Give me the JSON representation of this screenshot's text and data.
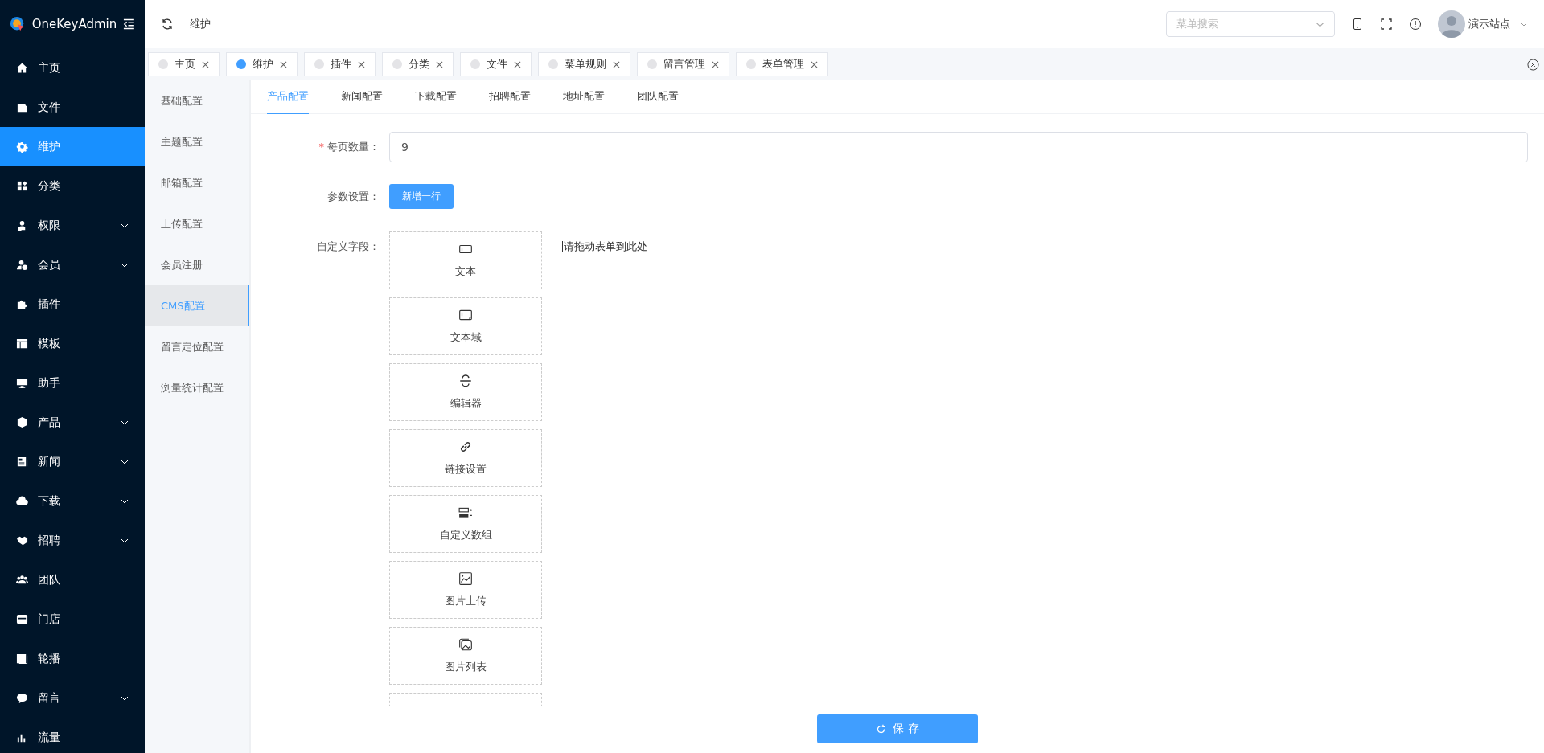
{
  "brand": {
    "name": "OneKeyAdmin"
  },
  "sidebar": {
    "items": [
      {
        "label": "主页",
        "selected": false,
        "expandable": false
      },
      {
        "label": "文件",
        "selected": false,
        "expandable": false
      },
      {
        "label": "维护",
        "selected": true,
        "expandable": false
      },
      {
        "label": "分类",
        "selected": false,
        "expandable": false
      },
      {
        "label": "权限",
        "selected": false,
        "expandable": true
      },
      {
        "label": "会员",
        "selected": false,
        "expandable": true
      },
      {
        "label": "插件",
        "selected": false,
        "expandable": false
      },
      {
        "label": "模板",
        "selected": false,
        "expandable": false
      },
      {
        "label": "助手",
        "selected": false,
        "expandable": false
      },
      {
        "label": "产品",
        "selected": false,
        "expandable": true
      },
      {
        "label": "新闻",
        "selected": false,
        "expandable": true
      },
      {
        "label": "下载",
        "selected": false,
        "expandable": true
      },
      {
        "label": "招聘",
        "selected": false,
        "expandable": true
      },
      {
        "label": "团队",
        "selected": false,
        "expandable": false
      },
      {
        "label": "门店",
        "selected": false,
        "expandable": false
      },
      {
        "label": "轮播",
        "selected": false,
        "expandable": false
      },
      {
        "label": "留言",
        "selected": false,
        "expandable": true
      },
      {
        "label": "流量",
        "selected": false,
        "expandable": false
      }
    ]
  },
  "header": {
    "breadcrumb": "维护",
    "menu_search": {
      "placeholder": "菜单搜索"
    },
    "user": "演示站点"
  },
  "tabs": [
    {
      "label": "主页",
      "selected": false
    },
    {
      "label": "维护",
      "selected": true
    },
    {
      "label": "插件",
      "selected": false
    },
    {
      "label": "分类",
      "selected": false
    },
    {
      "label": "文件",
      "selected": false
    },
    {
      "label": "菜单规则",
      "selected": false
    },
    {
      "label": "留言管理",
      "selected": false
    },
    {
      "label": "表单管理",
      "selected": false
    }
  ],
  "config_menu": [
    {
      "label": "基础配置",
      "selected": false
    },
    {
      "label": "主题配置",
      "selected": false
    },
    {
      "label": "邮箱配置",
      "selected": false
    },
    {
      "label": "上传配置",
      "selected": false
    },
    {
      "label": "会员注册",
      "selected": false
    },
    {
      "label": "CMS配置",
      "selected": true
    },
    {
      "label": "留言定位配置",
      "selected": false
    },
    {
      "label": "浏量统计配置",
      "selected": false
    }
  ],
  "sub_tabs": [
    {
      "label": "产品配置",
      "selected": true
    },
    {
      "label": "新闻配置",
      "selected": false
    },
    {
      "label": "下载配置",
      "selected": false
    },
    {
      "label": "招聘配置",
      "selected": false
    },
    {
      "label": "地址配置",
      "selected": false
    },
    {
      "label": "团队配置",
      "selected": false
    }
  ],
  "form": {
    "per_page": {
      "label": "每页数量：",
      "required_mark": "*",
      "value": "9"
    },
    "params": {
      "label": "参数设置：",
      "button": "新增一行"
    },
    "custom_fields": {
      "label": "自定义字段：",
      "drop_hint": "请拖动表单到此处",
      "components": [
        {
          "kind": "field",
          "label": "文本"
        },
        {
          "kind": "field",
          "label": "文本域"
        },
        {
          "kind": "field",
          "label": "编辑器"
        },
        {
          "kind": "field",
          "label": "链接设置"
        },
        {
          "kind": "field",
          "label": "自定义数组"
        },
        {
          "kind": "field",
          "label": "图片上传"
        },
        {
          "kind": "field",
          "label": "图片列表"
        },
        {
          "kind": "cut"
        }
      ]
    }
  },
  "save_button": "保 存"
}
